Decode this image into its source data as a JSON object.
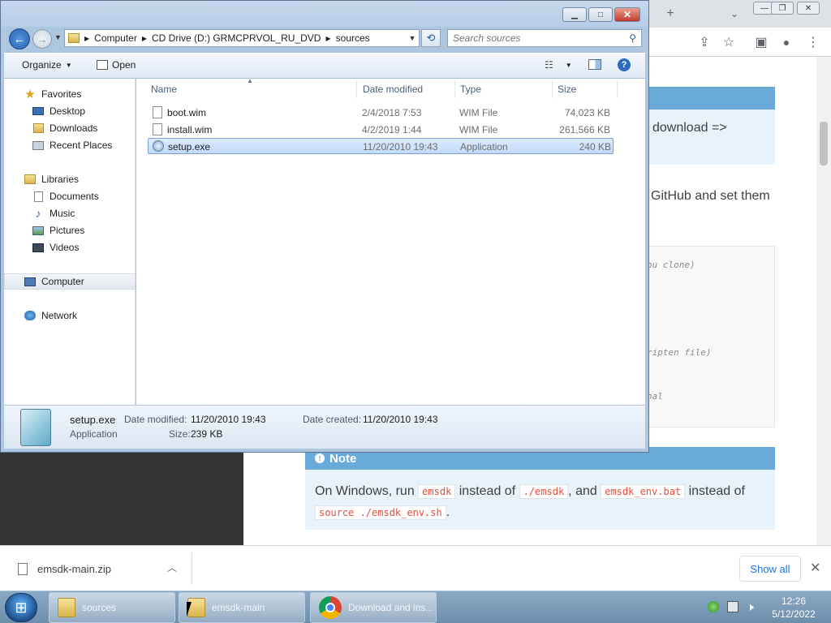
{
  "browser": {
    "doc": {
      "section_download_text": "download =>",
      "section_github_text": "GitHub and set them",
      "code_comments": [
        "ou clone)",
        "ripten file)",
        "nal"
      ],
      "note_title": "Note",
      "note_text_1": "On Windows, run",
      "note_code_1": "emsdk",
      "note_text_2": "instead of",
      "note_code_2": "./emsdk",
      "note_text_3": ", and",
      "note_code_3": "emsdk_env.bat",
      "note_text_4": "instead of",
      "note_code_4": "source ./emsdk_env.sh",
      "note_text_5": "."
    },
    "download_shelf": {
      "file_name": "emsdk-main.zip",
      "show_all_label": "Show all"
    }
  },
  "explorer": {
    "breadcrumb": [
      "Computer",
      "CD Drive (D:) GRMCPRVOL_RU_DVD",
      "sources"
    ],
    "search_placeholder": "Search sources",
    "command_bar": {
      "organize_label": "Organize",
      "open_label": "Open"
    },
    "nav": {
      "favorites_label": "Favorites",
      "favorites": [
        "Desktop",
        "Downloads",
        "Recent Places"
      ],
      "libraries_label": "Libraries",
      "libraries": [
        "Documents",
        "Music",
        "Pictures",
        "Videos"
      ],
      "computer_label": "Computer",
      "network_label": "Network"
    },
    "columns": {
      "name": "Name",
      "date": "Date modified",
      "type": "Type",
      "size": "Size"
    },
    "files": [
      {
        "name": "boot.wim",
        "date": "2/4/2018 7:53",
        "type": "WIM File",
        "size": "74,023 KB"
      },
      {
        "name": "install.wim",
        "date": "4/2/2019 1:44",
        "type": "WIM File",
        "size": "261,566 KB"
      },
      {
        "name": "setup.exe",
        "date": "11/20/2010 19:43",
        "type": "Application",
        "size": "240 KB"
      }
    ],
    "details": {
      "name": "setup.exe",
      "kind": "Application",
      "date_modified_label": "Date modified:",
      "date_modified": "11/20/2010 19:43",
      "date_created_label": "Date created:",
      "date_created": "11/20/2010 19:43",
      "size_label": "Size:",
      "size": "239 KB"
    }
  },
  "taskbar": {
    "buttons": [
      "sources",
      "emsdk-main",
      "Download and ins..."
    ],
    "clock_time": "12:26",
    "clock_date": "5/12/2022"
  }
}
